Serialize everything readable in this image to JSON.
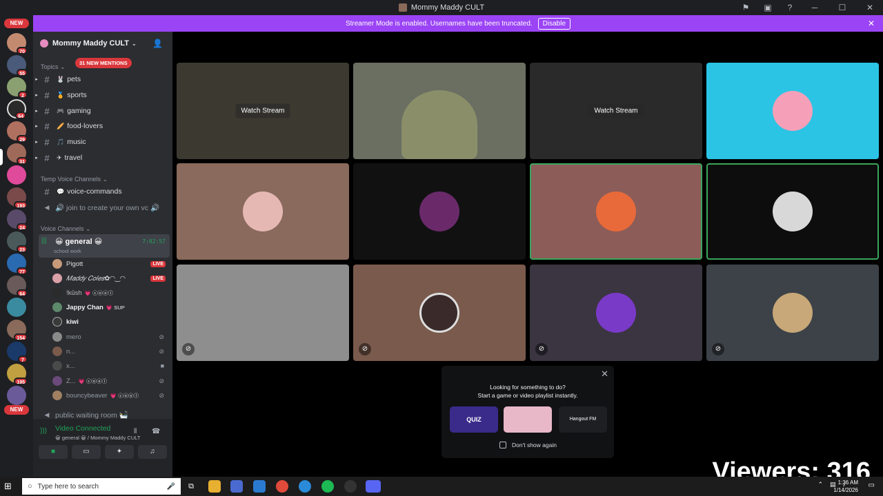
{
  "window": {
    "title": "Mommy Maddy CULT",
    "controls": [
      "─",
      "☐",
      "✕"
    ]
  },
  "banner": {
    "text": "Streamer Mode is enabled. Usernames have been truncated.",
    "disable_label": "Disable"
  },
  "server_list": {
    "top_new": "NEW",
    "bottom_new": "NEW",
    "badges": [
      "70",
      "55",
      "2",
      "64",
      "29",
      "31",
      "193",
      "24",
      "23",
      "77",
      "64",
      "154",
      "7",
      "195"
    ]
  },
  "guild": {
    "name": "Mommy Maddy CULT",
    "topics_label": "Topics",
    "mentions_label": "31 NEW MENTIONS",
    "topic_channels": [
      {
        "emoji": "🐰",
        "name": "pets"
      },
      {
        "emoji": "🏅",
        "name": "sports"
      },
      {
        "emoji": "🎮",
        "name": "gaming"
      },
      {
        "emoji": "🥖",
        "name": "food-lovers"
      },
      {
        "emoji": "🎵",
        "name": "music"
      },
      {
        "emoji": "✈",
        "name": "travel"
      }
    ],
    "temp_voice_label": "Temp Voice Channels",
    "temp_channels": [
      {
        "emoji": "💬",
        "name": "voice-commands"
      },
      {
        "emoji": "",
        "name": "🔊 join to create your own vc 🔊"
      }
    ],
    "voice_label": "Voice Channels",
    "voice_channel": {
      "name": "😀 general 😀",
      "status": "school work",
      "timer": "7:02:57"
    },
    "members": [
      {
        "name": "Pigott",
        "badge": "LIVE",
        "color": "#dbdee1",
        "avatar": "#c89a7a"
      },
      {
        "name": "𝑀𝑎𝑑𝑑𝑦 𝐶𝑜𝑙𝑒𝑠✿◠‿◠",
        "badge": "LIVE",
        "color": "#dbdee1",
        "avatar": "#d9a0a8"
      },
      {
        "name": "!kūsh",
        "tag": "💗 ⓒⓞⓞⓛ",
        "color": "#b5bac1",
        "avatar": "#2b2b2b"
      },
      {
        "name": "Jappy Chan",
        "tag": "💗 SUP",
        "color": "#f2f3f5",
        "avatar": "#5d8a6a"
      },
      {
        "name": "kiwi",
        "color": "#f2f3f5",
        "avatar": "#3a3a3a"
      },
      {
        "name": "mero",
        "color": "#949ba4",
        "avatar": "#8a8a8a",
        "muted": true
      },
      {
        "name": "n...",
        "color": "#949ba4",
        "avatar": "#7a5a4a",
        "muted": true
      },
      {
        "name": "x...",
        "color": "#949ba4",
        "avatar": "#4a4a4a",
        "video": true
      },
      {
        "name": "Z...",
        "tag": "💗 ⓒⓞⓞⓛ",
        "color": "#949ba4",
        "avatar": "#6a4a7a",
        "muted": true
      },
      {
        "name": "bouncybeaver",
        "tag": "💗 ⓒⓞⓞⓛ",
        "color": "#949ba4",
        "avatar": "#a08060",
        "muted": true
      }
    ],
    "waiting_room": "public waiting room 🛀"
  },
  "voice_panel": {
    "status": "Video Connected",
    "location": "😀 general 😀 / Mommy Maddy CULT"
  },
  "tiles": [
    {
      "type": "stream",
      "label": "Watch Stream",
      "bg": "#3c3a30"
    },
    {
      "type": "camera",
      "bg": "#6a6f62"
    },
    {
      "type": "stream",
      "label": "Watch Stream",
      "bg": "#2a2a2a"
    },
    {
      "type": "avatar",
      "bg": "#2bc4e4",
      "avatar": "#f5a0b8"
    },
    {
      "type": "avatar",
      "bg": "#8a6a5c",
      "avatar": "#e6b8b4"
    },
    {
      "type": "avatar",
      "bg": "#111111",
      "avatar": "#6a2a6a"
    },
    {
      "type": "avatar",
      "bg": "#8c5c58",
      "avatar": "#e86a3a",
      "speaking": true
    },
    {
      "type": "avatar",
      "bg": "#0d0d0d",
      "avatar": "#d8d8d8",
      "speaking": true
    },
    {
      "type": "avatar",
      "bg": "#8e8e8e",
      "avatar": "#8e8e8e",
      "muted": true
    },
    {
      "type": "avatar",
      "bg": "#7a5a4c",
      "avatar": "#3a2a2a",
      "muted": true
    },
    {
      "type": "avatar",
      "bg": "#3a3540",
      "avatar": "#7a3ac8",
      "muted": true
    },
    {
      "type": "avatar",
      "bg": "#3c4248",
      "avatar": "#c8a878",
      "muted": true
    }
  ],
  "activity": {
    "line1": "Looking for something to do?",
    "line2": "Start a game or video playlist instantly.",
    "tiles": [
      "QUIZ",
      "",
      "Hangout FM"
    ],
    "dont_show": "Don't show again"
  },
  "overlay": {
    "viewers": "Viewers: 316"
  },
  "taskbar": {
    "search_placeholder": "Type here to search",
    "time": "1:36 AM",
    "date": "1/14/2026"
  }
}
